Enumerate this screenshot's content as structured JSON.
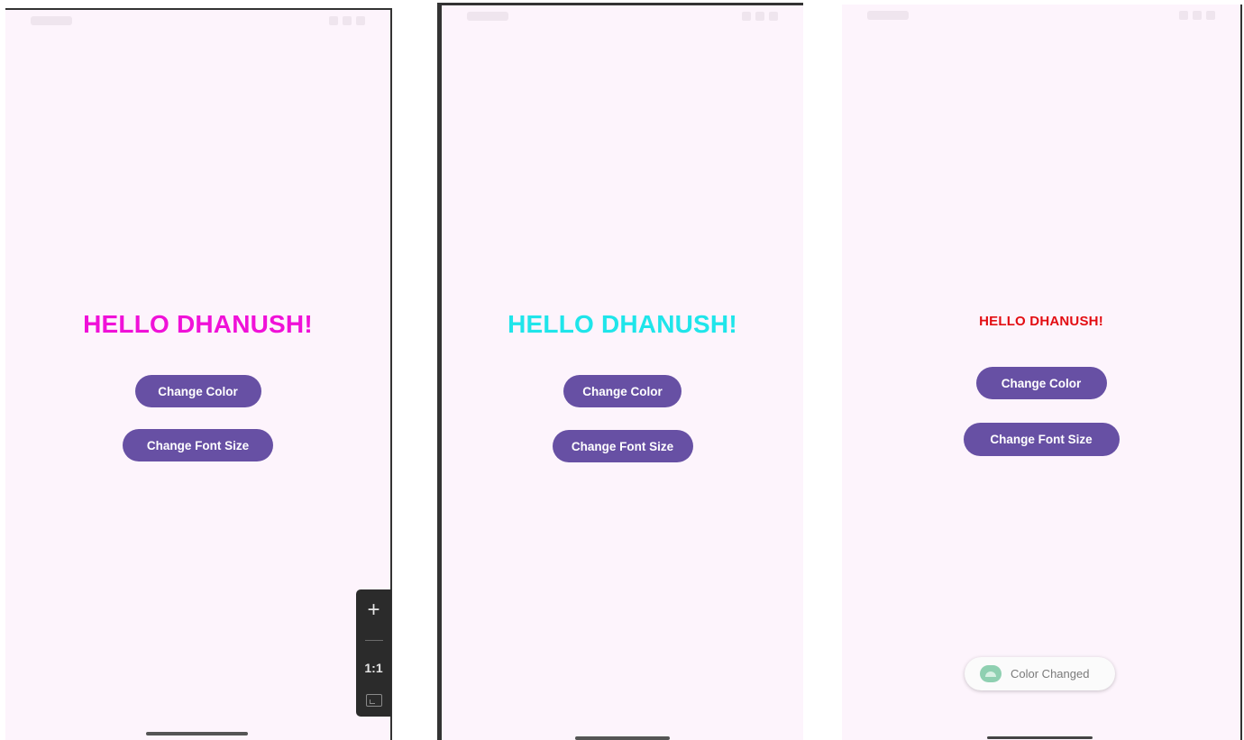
{
  "screens": [
    {
      "greeting": "HELLO DHANUSH!",
      "greeting_color": "#f011d8",
      "buttons": {
        "change_color": "Change Color",
        "change_font_size": "Change Font Size"
      }
    },
    {
      "greeting": "HELLO DHANUSH!",
      "greeting_color": "#1fe5ea",
      "buttons": {
        "change_color": "Change Color",
        "change_font_size": "Change Font Size"
      }
    },
    {
      "greeting": "HELLO DHANUSH!",
      "greeting_color": "#e30d12",
      "buttons": {
        "change_color": "Change Color",
        "change_font_size": "Change Font Size"
      },
      "toast": {
        "icon": "android-icon",
        "message": "Color Changed"
      }
    }
  ],
  "zoom_toolbar": {
    "zoom_in_icon": "plus-icon",
    "zoom_out_icon": "minus-icon",
    "ratio_label": "1:1",
    "fit_icon": "fit-screen-icon"
  },
  "theme": {
    "button_color": "#6750a4",
    "background_color": "#fdf4fc"
  }
}
